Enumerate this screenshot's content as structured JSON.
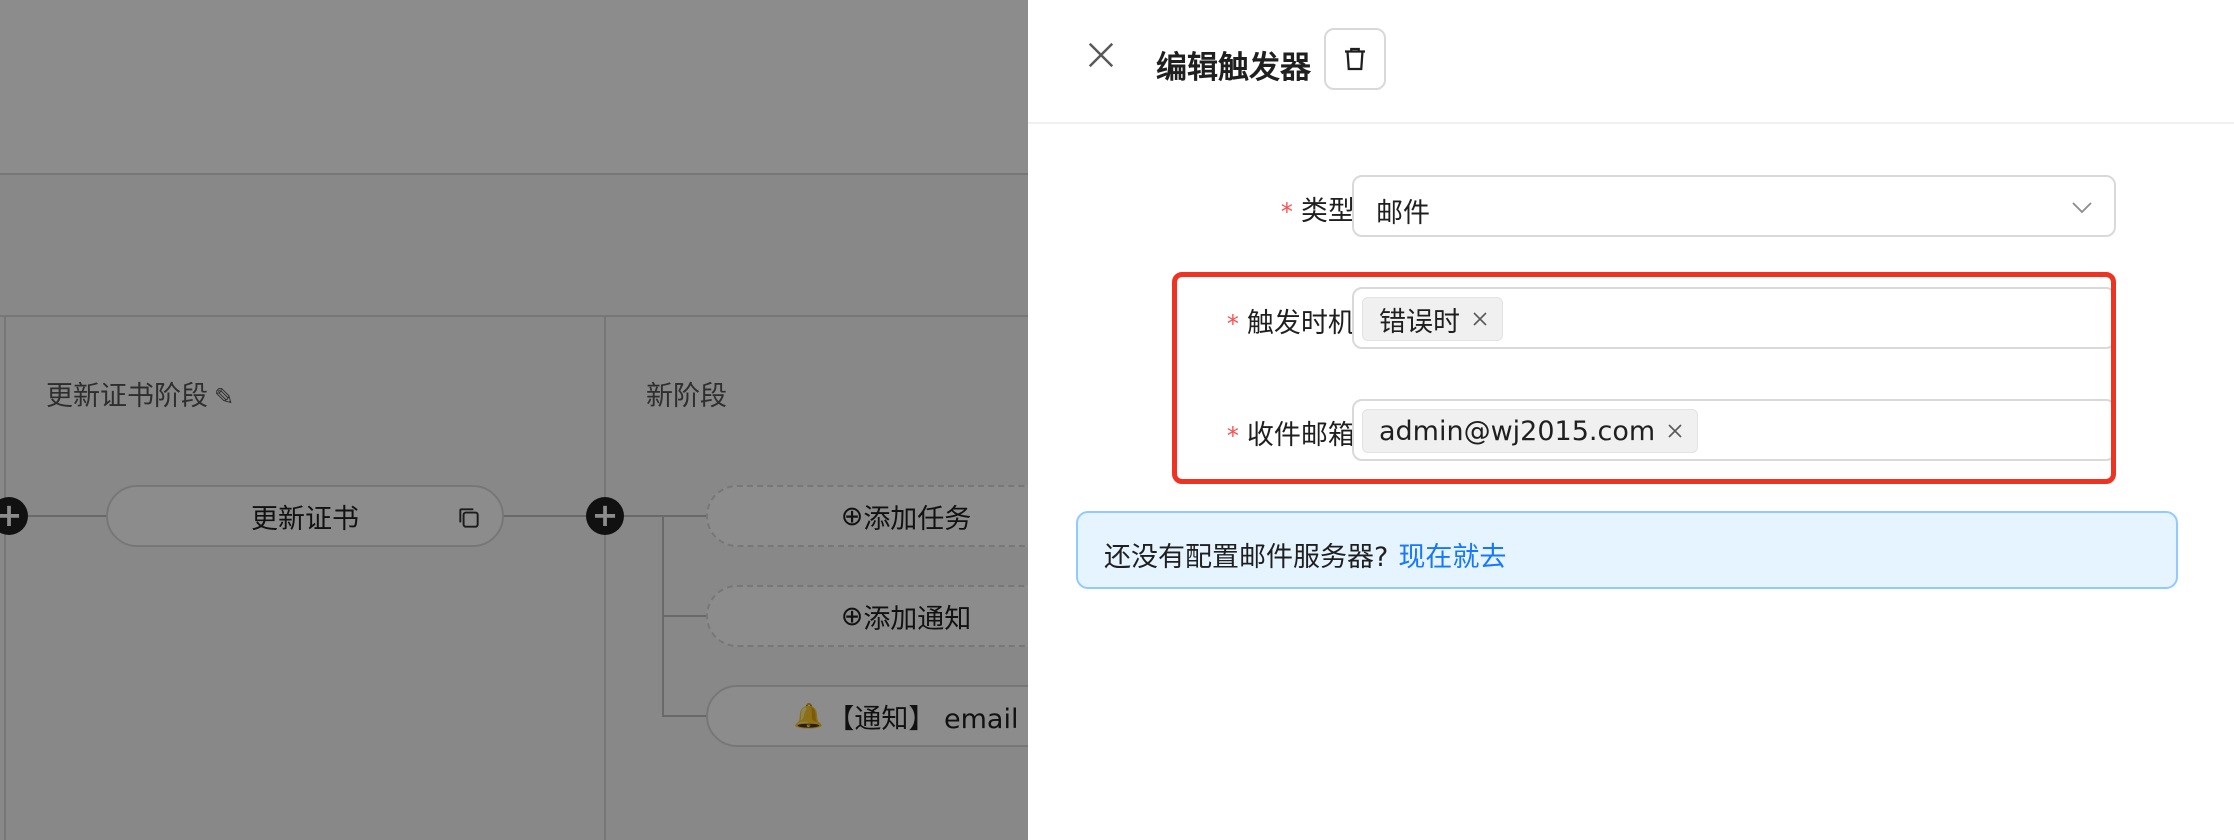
{
  "canvas": {
    "stages": [
      {
        "title": "更新证书阶段"
      },
      {
        "title": "新阶段"
      }
    ],
    "nodes": {
      "task_node": "更新证书",
      "add_task": "添加任务",
      "add_notice": "添加通知",
      "notice_item": "【通知】 email"
    },
    "icons": {
      "plus": "+",
      "circle_plus": "⊕",
      "pencil": "✎",
      "bell": "🔔"
    }
  },
  "drawer": {
    "title": "编辑触发器",
    "form": {
      "type": {
        "label": "类型:",
        "value": "邮件"
      },
      "trigger": {
        "label": "触发时机:",
        "tags": [
          "错误时"
        ]
      },
      "email": {
        "label": "收件邮箱:",
        "tags": [
          "admin@wj2015.com"
        ]
      }
    },
    "alert": {
      "text": "还没有配置邮件服务器?",
      "link": "现在就去"
    }
  },
  "colors": {
    "required": "#ff4d4f",
    "highlight": "#ee3322",
    "alert_bg": "#e6f4ff",
    "alert_border": "#91caff",
    "link": "#1677ff"
  }
}
